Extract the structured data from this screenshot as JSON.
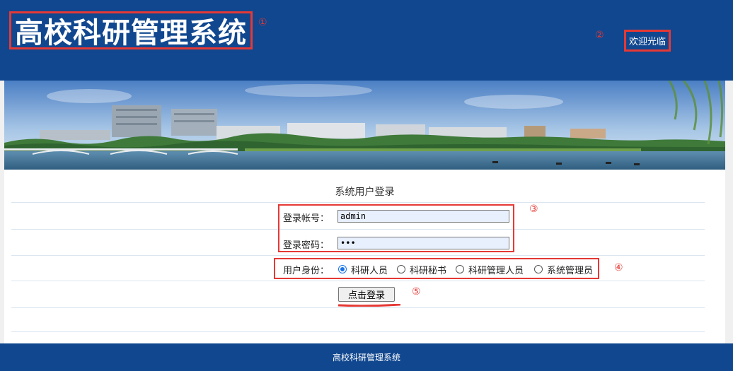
{
  "header": {
    "title": "高校科研管理系统",
    "welcome": "欢迎光临"
  },
  "markers": [
    "①",
    "②",
    "③",
    "④",
    "⑤"
  ],
  "login": {
    "title": "系统用户登录",
    "account_label": "登录帐号：",
    "account_value": "admin",
    "password_label": "登录密码：",
    "password_value": "•••",
    "role_label": "用户身份：",
    "roles": [
      {
        "label": "科研人员",
        "checked": true
      },
      {
        "label": "科研秘书",
        "checked": false
      },
      {
        "label": "科研管理人员",
        "checked": false
      },
      {
        "label": "系统管理员",
        "checked": false
      }
    ],
    "submit_label": "点击登录"
  },
  "footer": {
    "text": "高校科研管理系统"
  },
  "colors": {
    "header_bg": "#11478f",
    "annotation_red": "#e53935",
    "input_bg": "#e8f0fe"
  }
}
